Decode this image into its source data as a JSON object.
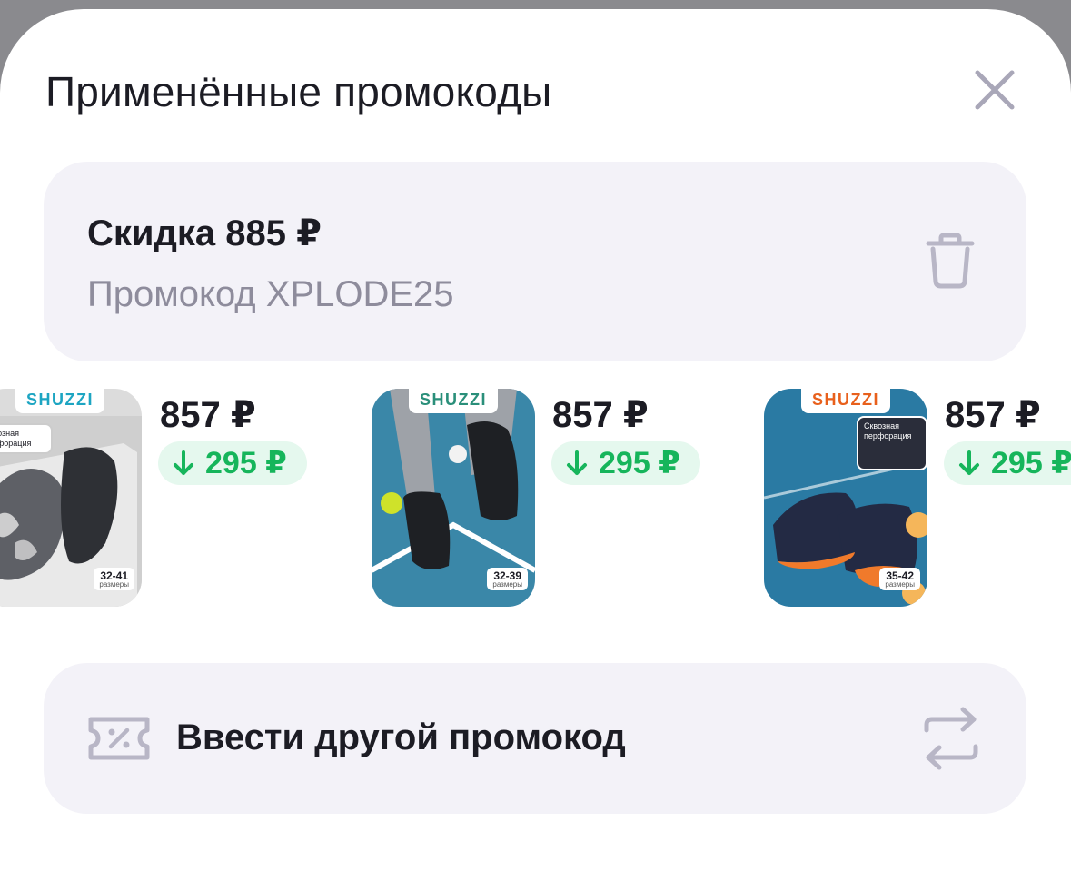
{
  "sheet": {
    "title": "Применённые промокоды",
    "close_icon": "close-icon"
  },
  "promo": {
    "discount_text": "Скидка 885 ₽",
    "code_text": "Промокод XPLODE25",
    "delete_icon": "trash-icon"
  },
  "products": [
    {
      "brand": "SHUZZI",
      "price": "857 ₽",
      "discount": "295 ₽",
      "sizes": "32-41",
      "sizes_label": "размеры",
      "perforation": "Сквозная перфорация"
    },
    {
      "brand": "SHUZZI",
      "price": "857 ₽",
      "discount": "295 ₽",
      "sizes": "32-39",
      "sizes_label": "размеры"
    },
    {
      "brand": "SHUZZI",
      "price": "857 ₽",
      "discount": "295 ₽",
      "sizes": "35-42",
      "sizes_label": "размеры",
      "perforation": "Сквозная перфорация"
    }
  ],
  "enter_promo": {
    "label": "Ввести другой промокод",
    "coupon_icon": "coupon-icon",
    "swap_icon": "swap-icon"
  },
  "colors": {
    "discount_green": "#16b55b",
    "discount_bg": "#e5f8ee",
    "card_bg": "#f3f2f8",
    "muted_text": "#8e8c9c",
    "icon_gray": "#b8b6c6"
  }
}
